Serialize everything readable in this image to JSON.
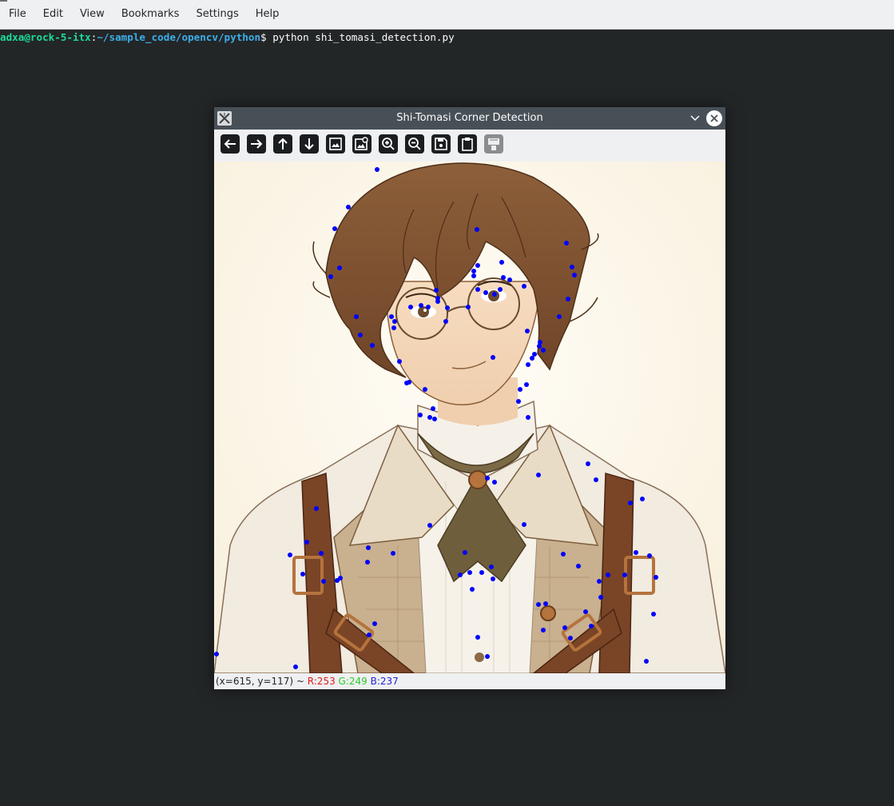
{
  "menubar": {
    "items": [
      "File",
      "Edit",
      "View",
      "Bookmarks",
      "Settings",
      "Help"
    ]
  },
  "terminal": {
    "user_host": "adxa@rock-5-itx",
    "separator": ":",
    "path": "~/sample_code/opencv/python",
    "prompt_char": "$ ",
    "command": "python shi_tomasi_detection.py"
  },
  "window": {
    "title": "Shi-Tomasi Corner Detection",
    "app_icon": "x11-app-icon",
    "toolbar_buttons": [
      {
        "name": "pan-left-button",
        "icon": "arrow-left-icon"
      },
      {
        "name": "pan-right-button",
        "icon": "arrow-right-icon"
      },
      {
        "name": "pan-up-button",
        "icon": "arrow-up-icon"
      },
      {
        "name": "pan-down-button",
        "icon": "arrow-down-icon"
      },
      {
        "name": "zoom-fit-button",
        "icon": "image-icon"
      },
      {
        "name": "zoom-original-button",
        "icon": "image-zoom-icon"
      },
      {
        "name": "zoom-in-button",
        "icon": "zoom-in-icon"
      },
      {
        "name": "zoom-out-button",
        "icon": "zoom-out-icon"
      },
      {
        "name": "save-image-button",
        "icon": "save-icon"
      },
      {
        "name": "copy-clipboard-button",
        "icon": "clipboard-icon"
      },
      {
        "name": "properties-button",
        "icon": "properties-icon"
      }
    ]
  },
  "status": {
    "coords": "(x=615, y=117) ~ ",
    "r": "R:253",
    "g": "G:249",
    "b": "B:237"
  },
  "colors": {
    "terminal_bg": "#232627",
    "prompt_user": "#1cdc9a",
    "prompt_path": "#3daee9",
    "corner_marker": "#0000ff",
    "image_bg": "#fdf8ed"
  }
}
